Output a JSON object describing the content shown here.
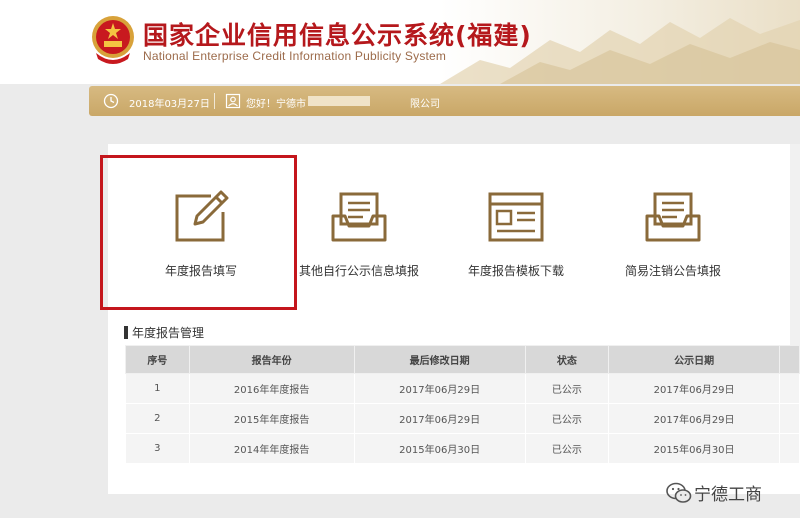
{
  "header": {
    "title": "国家企业信用信息公示系统(福建)",
    "subtitle": "National Enterprise Credit Information Publicity System"
  },
  "infobar": {
    "date": "2018年03月27日",
    "greeting_prefix": "您好！宁德市",
    "greeting_suffix": "限公司"
  },
  "actions": [
    {
      "label": "年度报告填写",
      "icon": "edit-icon"
    },
    {
      "label": "其他自行公示信息填报",
      "icon": "inbox-form-icon"
    },
    {
      "label": "年度报告模板下载",
      "icon": "template-icon"
    },
    {
      "label": "简易注销公告填报",
      "icon": "inbox-form-icon"
    }
  ],
  "section": {
    "title": "年度报告管理"
  },
  "table": {
    "headers": [
      "序号",
      "报告年份",
      "最后修改日期",
      "状态",
      "公示日期"
    ],
    "rows": [
      [
        "1",
        "2016年年度报告",
        "2017年06月29日",
        "已公示",
        "2017年06月29日"
      ],
      [
        "2",
        "2015年年度报告",
        "2017年06月29日",
        "已公示",
        "2017年06月29日"
      ],
      [
        "3",
        "2014年年度报告",
        "2015年06月30日",
        "已公示",
        "2015年06月30日"
      ]
    ]
  },
  "watermark": {
    "text": "宁德工商"
  },
  "colors": {
    "brand_red": "#b5181c",
    "gold": "#c9a767",
    "highlight_red": "#c4161c",
    "icon_brown": "#8a6a3a"
  }
}
